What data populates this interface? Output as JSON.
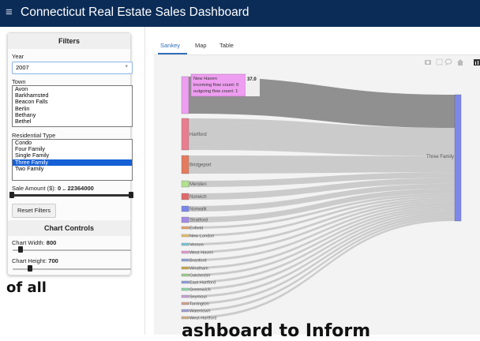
{
  "header": {
    "menu_icon": "hamburger-menu-icon",
    "title": "Connecticut Real Estate Sales Dashboard"
  },
  "filters": {
    "title": "Filters",
    "year_label": "Year",
    "year_value": "2007",
    "town_label": "Town",
    "towns": [
      "Avon",
      "Barkhamsted",
      "Beacon Falls",
      "Berlin",
      "Bethany",
      "Bethel"
    ],
    "residential_type_label": "Residential Type",
    "residential_types": [
      "Condo",
      "Four Family",
      "Single Family",
      "Three Family",
      "Two Family"
    ],
    "residential_type_selected": "Three Family",
    "sale_amount_label": "Sale Amount ($):",
    "sale_amount_value": "0 .. 22364000",
    "sale_amount_range": [
      0,
      22364000
    ],
    "reset_label": "Reset Filters"
  },
  "chart_controls": {
    "title": "Chart Controls",
    "width_label": "Chart Width:",
    "width_value": "800",
    "height_label": "Chart Height:",
    "height_value": "700"
  },
  "tabs": [
    {
      "label": "Sankey",
      "active": true
    },
    {
      "label": "Map",
      "active": false
    },
    {
      "label": "Table",
      "active": false
    }
  ],
  "modebar_icons": [
    "camera-icon",
    "box-select-icon",
    "lasso-icon",
    "home-icon",
    "plotly-logo-icon"
  ],
  "chart_data": {
    "type": "sankey",
    "target": "Three Family",
    "sources": [
      "New Haven",
      "Hartford",
      "Bridgeport",
      "Meriden",
      "Norwich",
      "Norwalk",
      "Stratford",
      "Enfield",
      "New London",
      "Vernon",
      "West Haven",
      "Branford",
      "Windham",
      "Colchester",
      "East Hartford",
      "Greenwich",
      "Seymour",
      "Torrington",
      "Watertown",
      "West Hartford"
    ],
    "colors": [
      "#ee9ef0",
      "#e97d8f",
      "#e47a5e",
      "#b3e08f",
      "#e06a6a",
      "#7a86e8",
      "#a48ae6",
      "#e8a36a",
      "#e8c06a",
      "#7ac7d6",
      "#e89ad2",
      "#8fa3d6",
      "#c8a84e",
      "#9fcf8f",
      "#8f9fe0",
      "#8fd6a8",
      "#c8a0d8",
      "#d6a08f",
      "#a0a0d6",
      "#d0b08a"
    ],
    "target_color": "#7f88ea",
    "tooltip": {
      "node": "New Haven",
      "value": "37.0",
      "incoming": "incoming flow count: 0",
      "outgoing": "outgoing flow count: 1"
    }
  },
  "overlay_text": {
    "left": "of all",
    "bottom": "ashboard to Inform"
  }
}
